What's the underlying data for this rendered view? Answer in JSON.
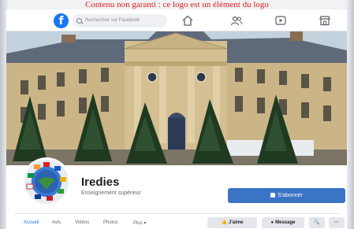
{
  "banner": {
    "text": "Contenu non garanti : ce logo est un élément du logo"
  },
  "topbar": {
    "logo": "f",
    "search": {
      "placeholder": "Rechercher sur Facebook"
    },
    "icons": [
      "home-icon",
      "friends-icon",
      "video-icon",
      "marketplace-icon"
    ]
  },
  "page": {
    "name": "Iredies",
    "category": "Enseignement supérieur",
    "subscribe_label": "S'abonner"
  },
  "tabs": [
    {
      "label": "Accueil",
      "active": true
    },
    {
      "label": "Avis"
    },
    {
      "label": "Vidéos"
    },
    {
      "label": "Photos"
    },
    {
      "label": "Plus ▾"
    }
  ],
  "actions": {
    "like": "J'aime",
    "message": "Message",
    "search": "🔍",
    "more": "···"
  },
  "colors": {
    "brand": "#1877f2",
    "button": "#3b74c5"
  }
}
